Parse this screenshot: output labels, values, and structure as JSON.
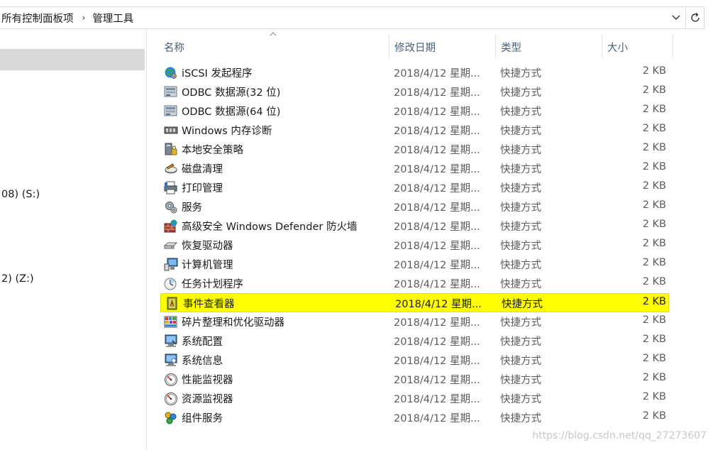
{
  "address": {
    "crumbs": [
      "所有控制面板项",
      "管理工具"
    ],
    "separator": "›"
  },
  "nav": {
    "items": [
      "08) (S:)",
      "2) (Z:)"
    ]
  },
  "columns": {
    "name": "名称",
    "date": "修改日期",
    "type": "类型",
    "size": "大小",
    "sorted_by": "名称"
  },
  "rows": [
    {
      "name": "iSCSI 发起程序",
      "date": "2018/4/12 星期...",
      "type": "快捷方式",
      "size": "2 KB",
      "icon": "globe-icon"
    },
    {
      "name": "ODBC 数据源(32 位)",
      "date": "2018/4/12 星期...",
      "type": "快捷方式",
      "size": "2 KB",
      "icon": "database-icon"
    },
    {
      "name": "ODBC 数据源(64 位)",
      "date": "2018/4/12 星期...",
      "type": "快捷方式",
      "size": "2 KB",
      "icon": "database-icon"
    },
    {
      "name": "Windows 内存诊断",
      "date": "2018/4/12 星期...",
      "type": "快捷方式",
      "size": "2 KB",
      "icon": "memory-chip-icon"
    },
    {
      "name": "本地安全策略",
      "date": "2018/4/12 星期...",
      "type": "快捷方式",
      "size": "2 KB",
      "icon": "security-policy-icon"
    },
    {
      "name": "磁盘清理",
      "date": "2018/4/12 星期...",
      "type": "快捷方式",
      "size": "2 KB",
      "icon": "disk-cleanup-icon"
    },
    {
      "name": "打印管理",
      "date": "2018/4/12 星期...",
      "type": "快捷方式",
      "size": "2 KB",
      "icon": "printer-icon"
    },
    {
      "name": "服务",
      "date": "2018/4/12 星期...",
      "type": "快捷方式",
      "size": "2 KB",
      "icon": "gears-icon"
    },
    {
      "name": "高级安全 Windows Defender 防火墙",
      "date": "2018/4/12 星期...",
      "type": "快捷方式",
      "size": "2 KB",
      "icon": "firewall-icon"
    },
    {
      "name": "恢复驱动器",
      "date": "2018/4/12 星期...",
      "type": "快捷方式",
      "size": "2 KB",
      "icon": "drive-icon"
    },
    {
      "name": "计算机管理",
      "date": "2018/4/12 星期...",
      "type": "快捷方式",
      "size": "2 KB",
      "icon": "computer-management-icon"
    },
    {
      "name": "任务计划程序",
      "date": "2018/4/12 星期...",
      "type": "快捷方式",
      "size": "2 KB",
      "icon": "clock-icon"
    },
    {
      "name": "事件查看器",
      "date": "2018/4/12 星期...",
      "type": "快捷方式",
      "size": "2 KB",
      "icon": "event-viewer-icon",
      "highlighted": true
    },
    {
      "name": "碎片整理和优化驱动器",
      "date": "2018/4/12 星期...",
      "type": "快捷方式",
      "size": "2 KB",
      "icon": "defrag-icon"
    },
    {
      "name": "系统配置",
      "date": "2018/4/12 星期...",
      "type": "快捷方式",
      "size": "2 KB",
      "icon": "system-config-icon"
    },
    {
      "name": "系统信息",
      "date": "2018/4/12 星期...",
      "type": "快捷方式",
      "size": "2 KB",
      "icon": "system-info-icon"
    },
    {
      "name": "性能监视器",
      "date": "2018/4/12 星期...",
      "type": "快捷方式",
      "size": "2 KB",
      "icon": "gauge-icon"
    },
    {
      "name": "资源监视器",
      "date": "2018/4/12 星期...",
      "type": "快捷方式",
      "size": "2 KB",
      "icon": "gauge-icon"
    },
    {
      "name": "组件服务",
      "date": "2018/4/12 星期...",
      "type": "快捷方式",
      "size": "2 KB",
      "icon": "component-services-icon"
    }
  ],
  "watermark": "https://blog.csdn.net/qq_27273607",
  "colors": {
    "highlight": "#ffff00",
    "nav_selected": "#d9d9d9",
    "header_text": "#4c607a"
  }
}
